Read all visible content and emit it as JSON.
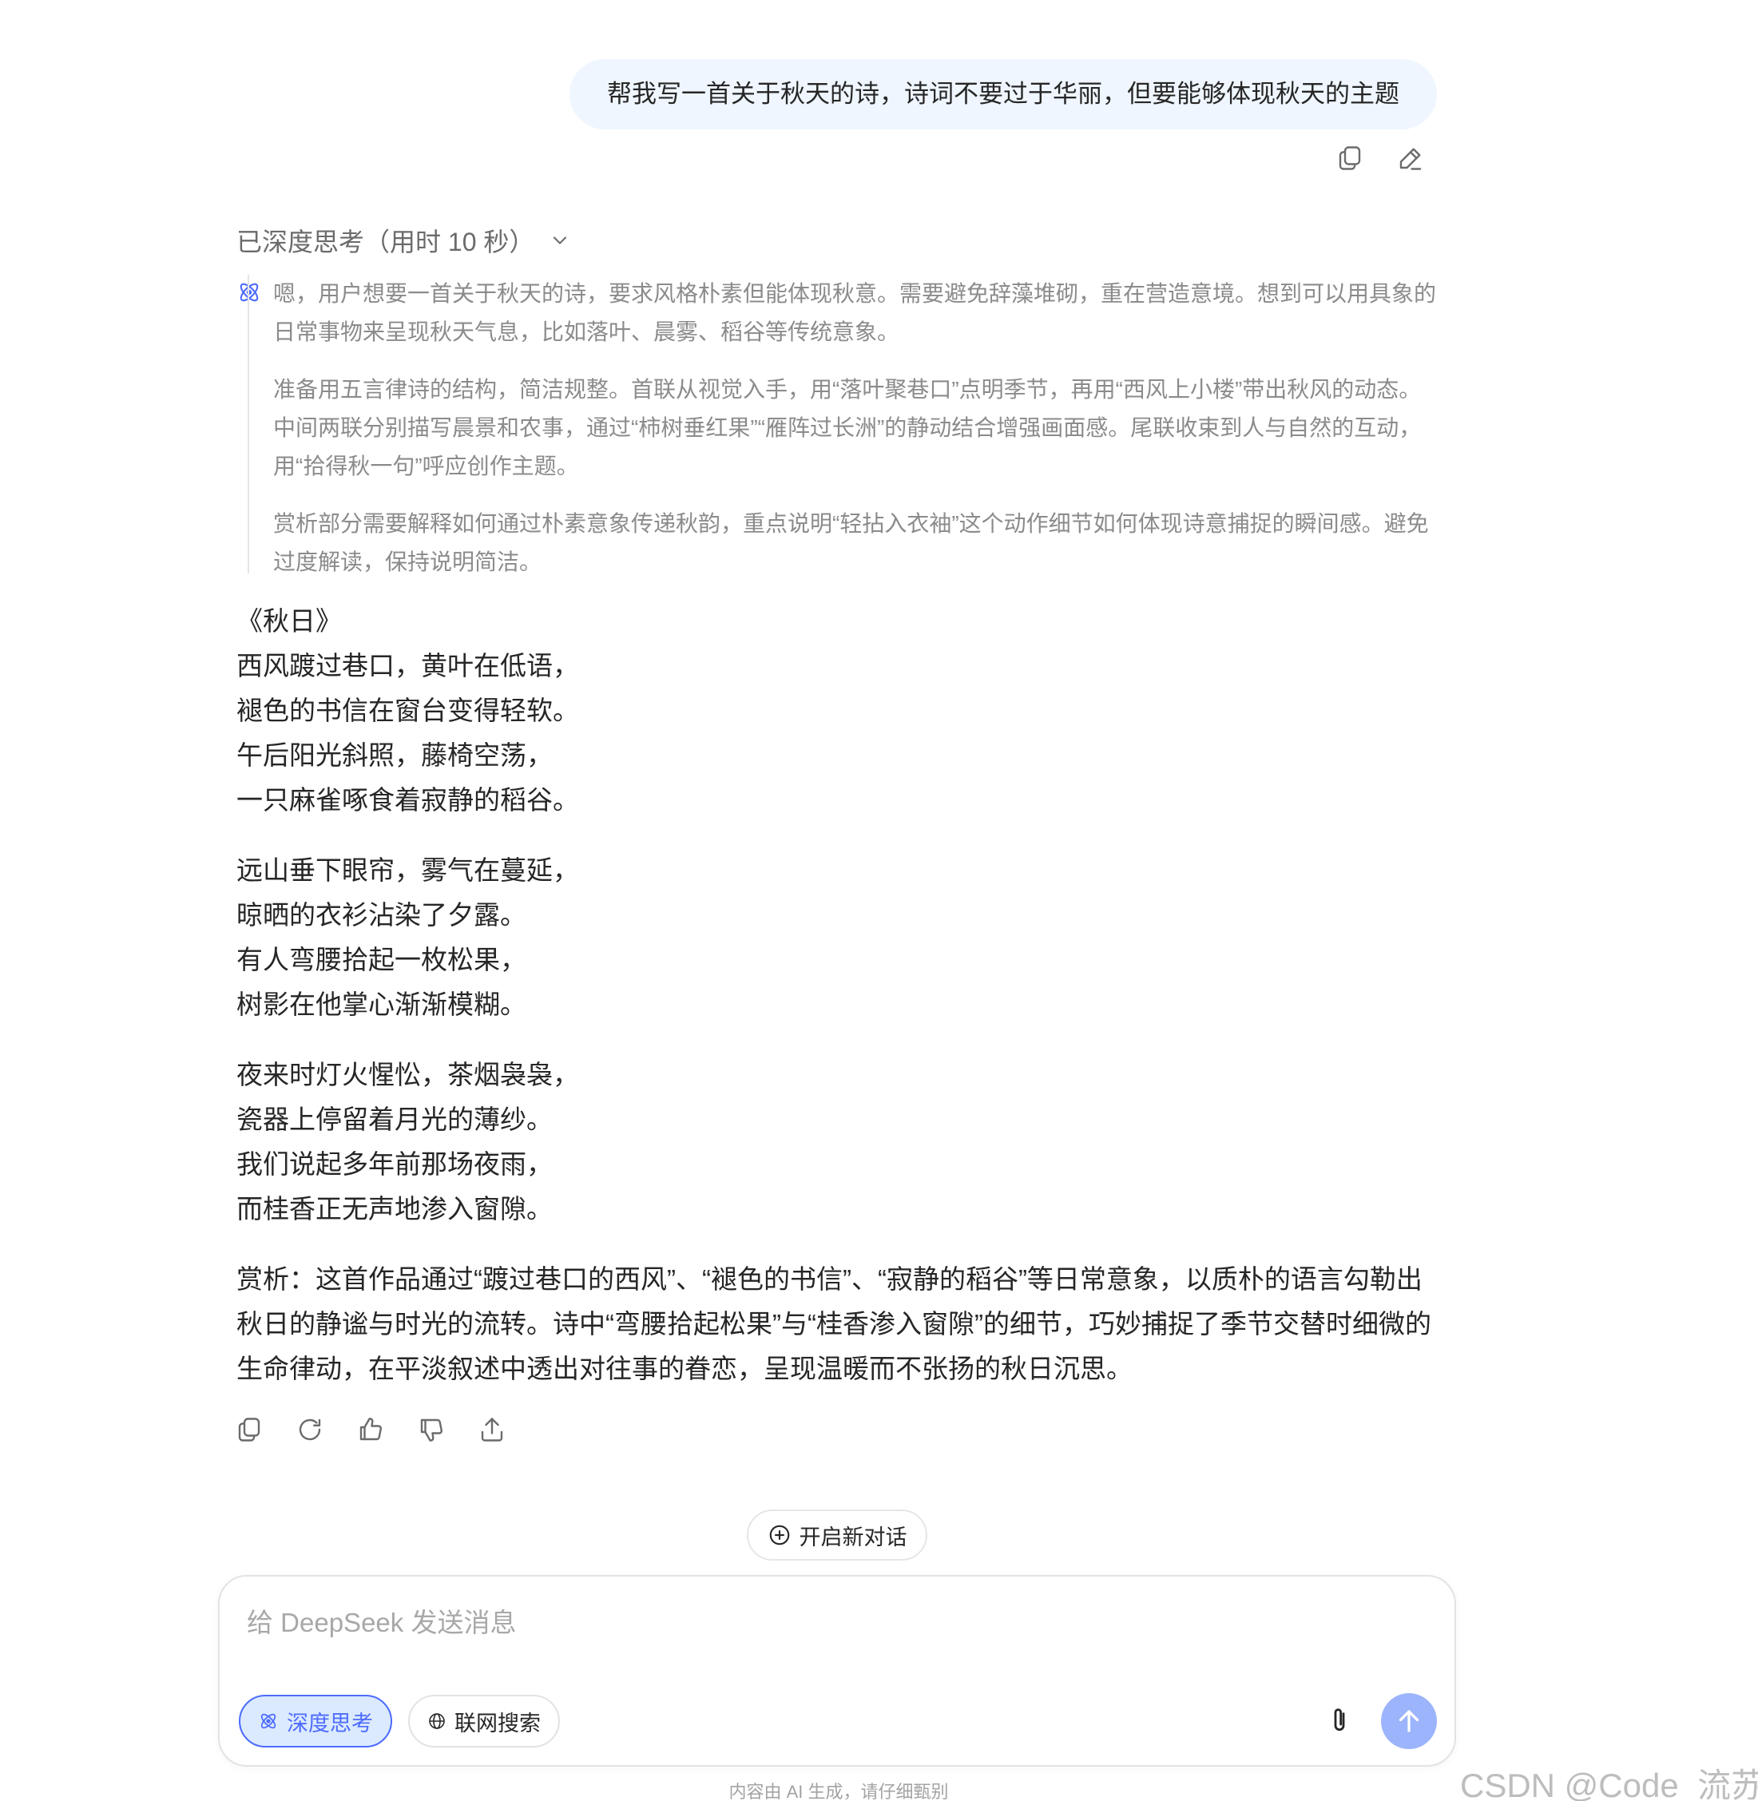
{
  "user_message": {
    "text": "帮我写一首关于秋天的诗，诗词不要过于华丽，但要能够体现秋天的主题"
  },
  "message_actions": {
    "icons": [
      "copy-icon",
      "edit-icon"
    ]
  },
  "thinking": {
    "toggle_label": "已深度思考（用时 10 秒）",
    "paragraphs": [
      "嗯，用户想要一首关于秋天的诗，要求风格朴素但能体现秋意。需要避免辞藻堆砌，重在营造意境。想到可以用具象的日常事物来呈现秋天气息，比如落叶、晨雾、稻谷等传统意象。",
      "准备用五言律诗的结构，简洁规整。首联从视觉入手，用“落叶聚巷口”点明季节，再用“西风上小楼”带出秋风的动态。中间两联分别描写晨景和农事，通过“柿树垂红果”“雁阵过长洲”的静动结合增强画面感。尾联收束到人与自然的互动，用“拾得秋一句”呼应创作主题。",
      "赏析部分需要解释如何通过朴素意象传递秋韵，重点说明“轻拈入衣袖”这个动作细节如何体现诗意捕捉的瞬间感。避免过度解读，保持说明简洁。"
    ]
  },
  "answer": {
    "poem_title": "《秋日》",
    "stanzas": [
      [
        "西风踱过巷口，黄叶在低语，",
        "褪色的书信在窗台变得轻软。",
        "午后阳光斜照，藤椅空荡，",
        "一只麻雀啄食着寂静的稻谷。"
      ],
      [
        "远山垂下眼帘，雾气在蔓延，",
        "晾晒的衣衫沾染了夕露。",
        "有人弯腰拾起一枚松果，",
        "树影在他掌心渐渐模糊。"
      ],
      [
        "夜来时灯火惺忪，茶烟袅袅，",
        "瓷器上停留着月光的薄纱。",
        "我们说起多年前那场夜雨，",
        "而桂香正无声地渗入窗隙。"
      ]
    ],
    "analysis": "赏析：这首作品通过“踱过巷口的西风”、“褪色的书信”、“寂静的稻谷”等日常意象，以质朴的语言勾勒出秋日的静谧与时光的流转。诗中“弯腰拾起松果”与“桂香渗入窗隙”的细节，巧妙捕捉了季节交替时细微的生命律动，在平淡叙述中透出对往事的眷恋，呈现温暖而不张扬的秋日沉思。"
  },
  "answer_actions": {
    "icons": [
      "copy-icon",
      "regenerate-icon",
      "thumbs-up-icon",
      "thumbs-down-icon",
      "share-icon"
    ]
  },
  "new_chat": {
    "label": "开启新对话"
  },
  "composer": {
    "placeholder": "给 DeepSeek 发送消息",
    "value": "",
    "deep_think_label": "深度思考",
    "web_search_label": "联网搜索"
  },
  "colors": {
    "accent": "#4d6bfe",
    "bubble": "#eff6ff",
    "send_disabled": "#9cb4fc"
  },
  "footer": {
    "disclaimer": "内容由 AI 生成，请仔细甄别",
    "watermark": "CSDN @Code_流苏"
  }
}
